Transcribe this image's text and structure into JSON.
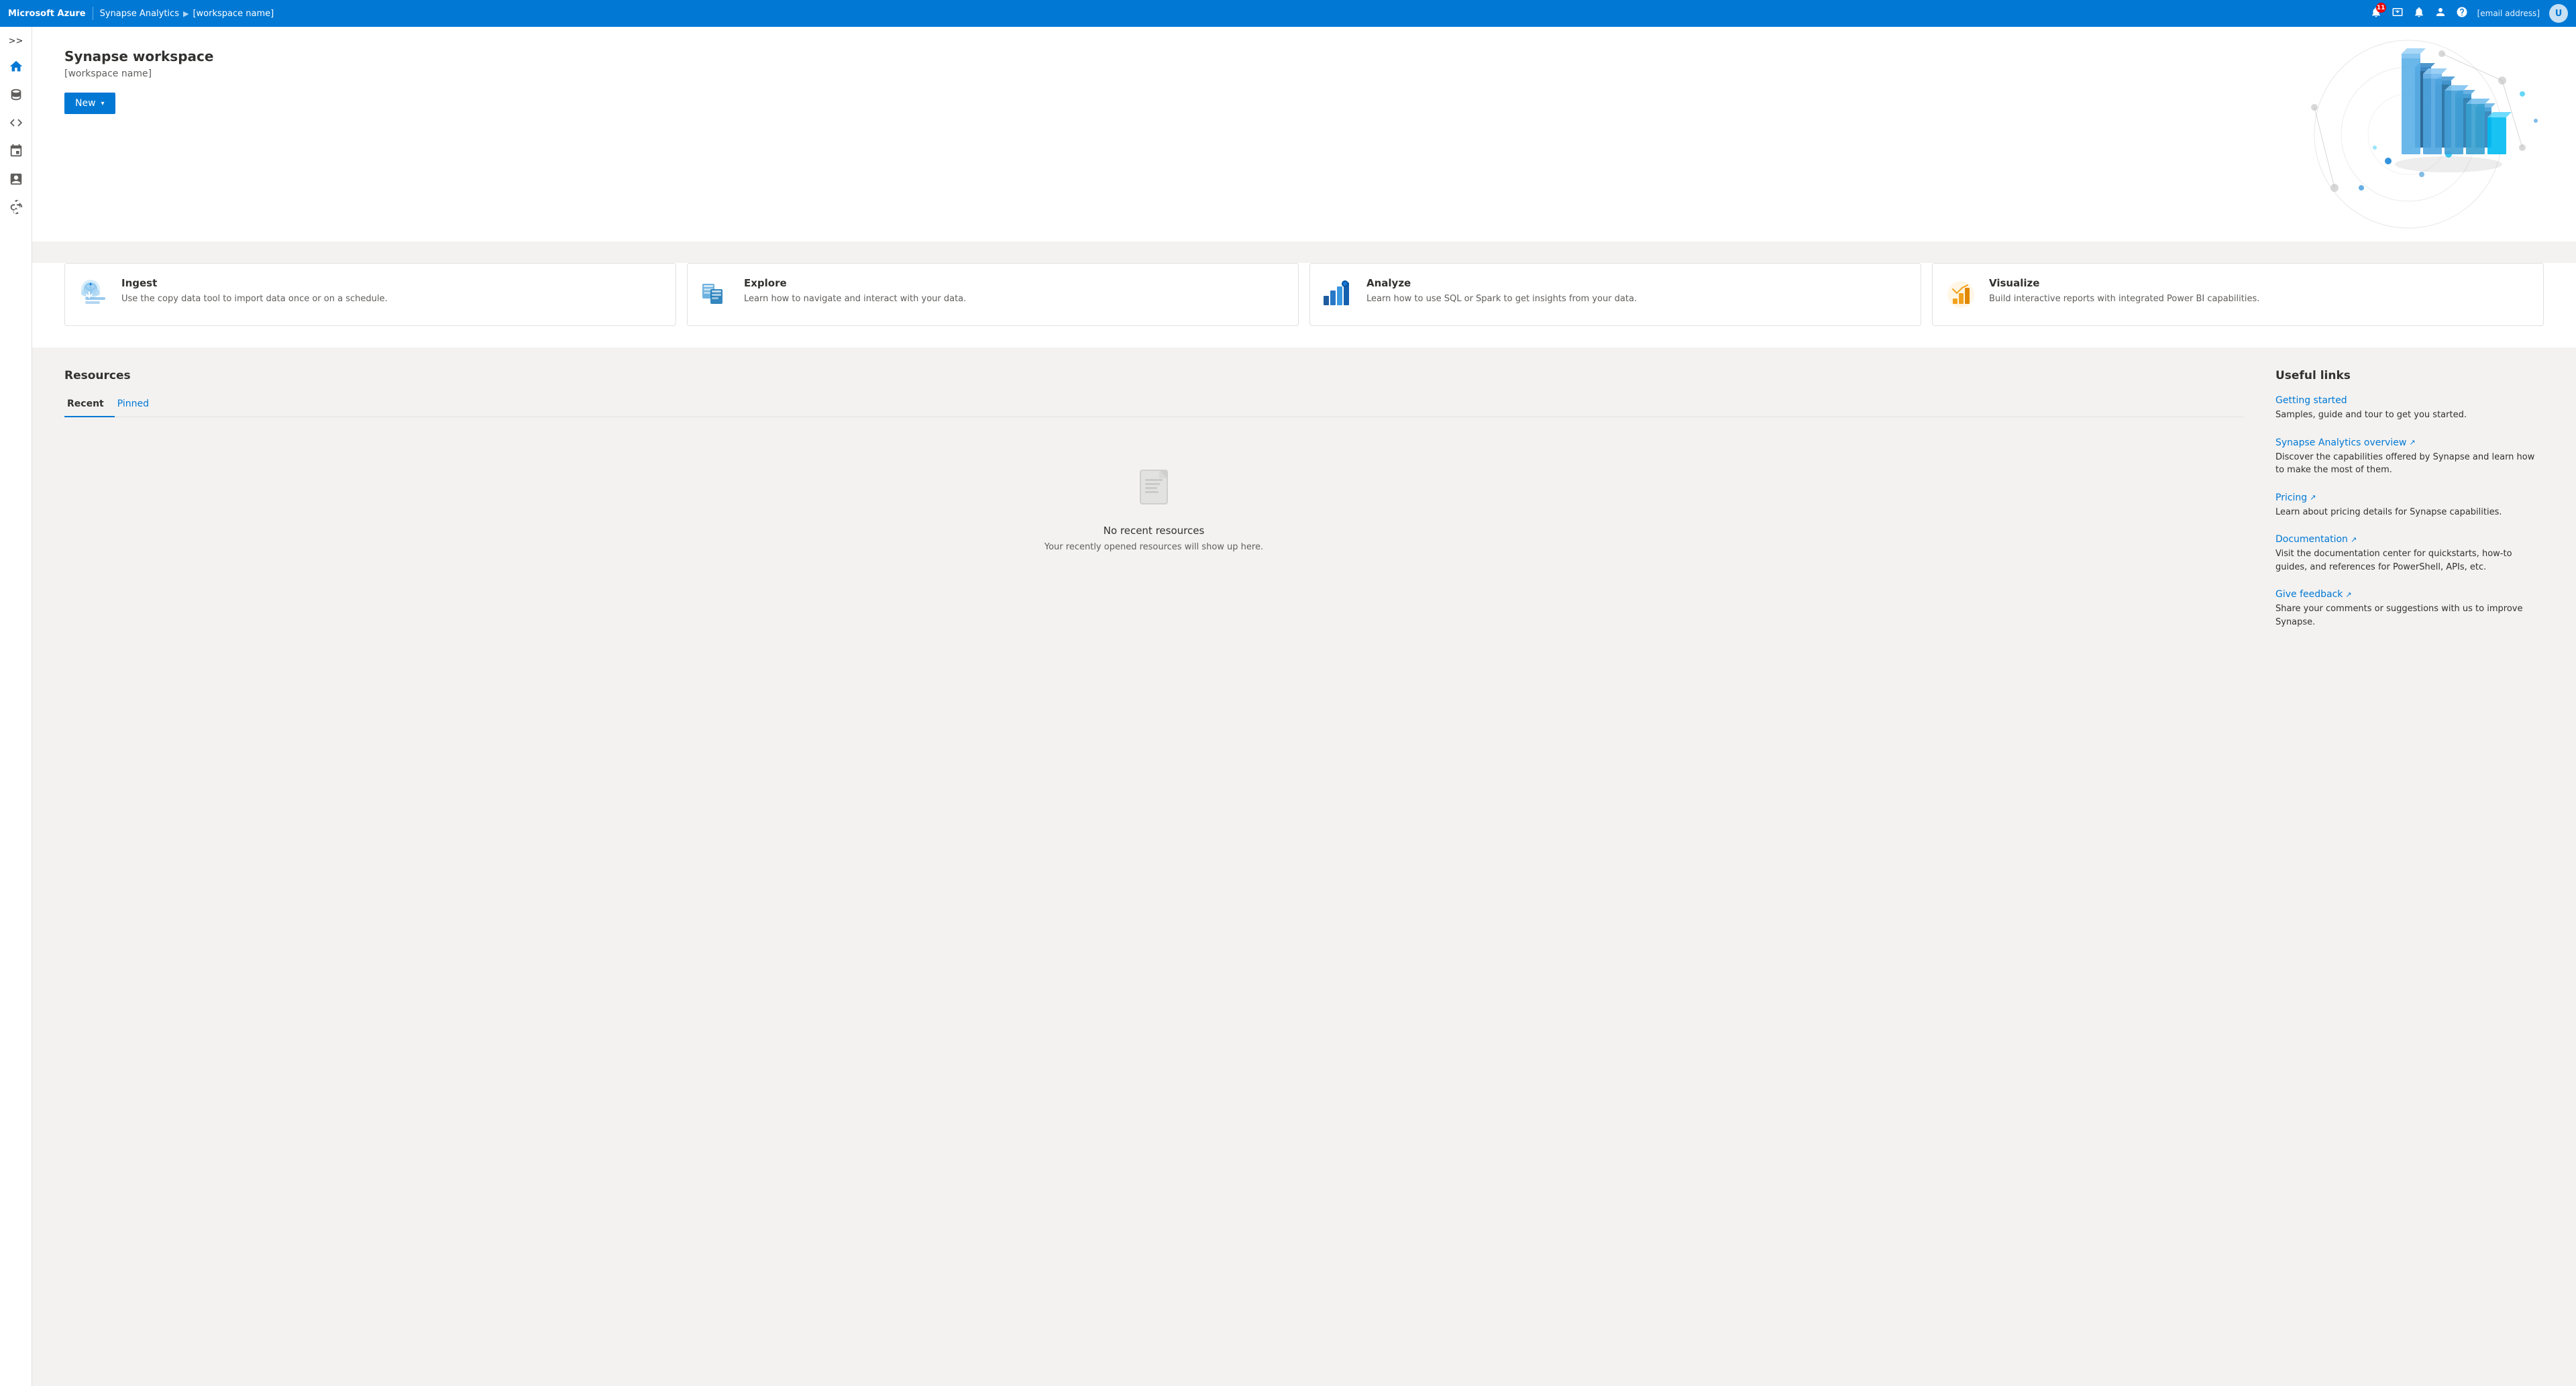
{
  "topbar": {
    "brand": "Microsoft Azure",
    "app": "Synapse Analytics",
    "workspace": "[workspace name]",
    "notification_count": "11",
    "email": "[email address]",
    "avatar_initial": "U"
  },
  "sidebar": {
    "toggle_label": ">>",
    "items": [
      {
        "id": "home",
        "label": "Home",
        "icon": "home"
      },
      {
        "id": "data",
        "label": "Data",
        "icon": "database"
      },
      {
        "id": "develop",
        "label": "Develop",
        "icon": "code"
      },
      {
        "id": "integrate",
        "label": "Integrate",
        "icon": "integrate"
      },
      {
        "id": "monitor",
        "label": "Monitor",
        "icon": "monitor"
      },
      {
        "id": "manage",
        "label": "Manage",
        "icon": "manage"
      }
    ]
  },
  "hero": {
    "title": "Synapse workspace",
    "subtitle": "[workspace name]",
    "new_button": "New"
  },
  "action_cards": [
    {
      "id": "ingest",
      "title": "Ingest",
      "description": "Use the copy data tool to import data once or on a schedule.",
      "icon_color": "#0078d4"
    },
    {
      "id": "explore",
      "title": "Explore",
      "description": "Learn how to navigate and interact with your data.",
      "icon_color": "#0078d4"
    },
    {
      "id": "analyze",
      "title": "Analyze",
      "description": "Learn how to use SQL or Spark to get insights from your data.",
      "icon_color": "#0078d4"
    },
    {
      "id": "visualize",
      "title": "Visualize",
      "description": "Build interactive reports with integrated Power BI capabilities.",
      "icon_color": "#f2a11c"
    }
  ],
  "resources": {
    "section_title": "Resources",
    "tabs": [
      {
        "label": "Recent",
        "active": true
      },
      {
        "label": "Pinned",
        "active": false
      }
    ],
    "empty_title": "No recent resources",
    "empty_desc": "Your recently opened resources will show up here."
  },
  "useful_links": {
    "section_title": "Useful links",
    "links": [
      {
        "title": "Getting started",
        "description": "Samples, guide and tour to get you started.",
        "external": false
      },
      {
        "title": "Synapse Analytics overview",
        "description": "Discover the capabilities offered by Synapse and learn how to make the most of them.",
        "external": true
      },
      {
        "title": "Pricing",
        "description": "Learn about pricing details for Synapse capabilities.",
        "external": true
      },
      {
        "title": "Documentation",
        "description": "Visit the documentation center for quickstarts, how-to guides, and references for PowerShell, APIs, etc.",
        "external": true
      },
      {
        "title": "Give feedback",
        "description": "Share your comments or suggestions with us to improve Synapse.",
        "external": true
      }
    ]
  }
}
